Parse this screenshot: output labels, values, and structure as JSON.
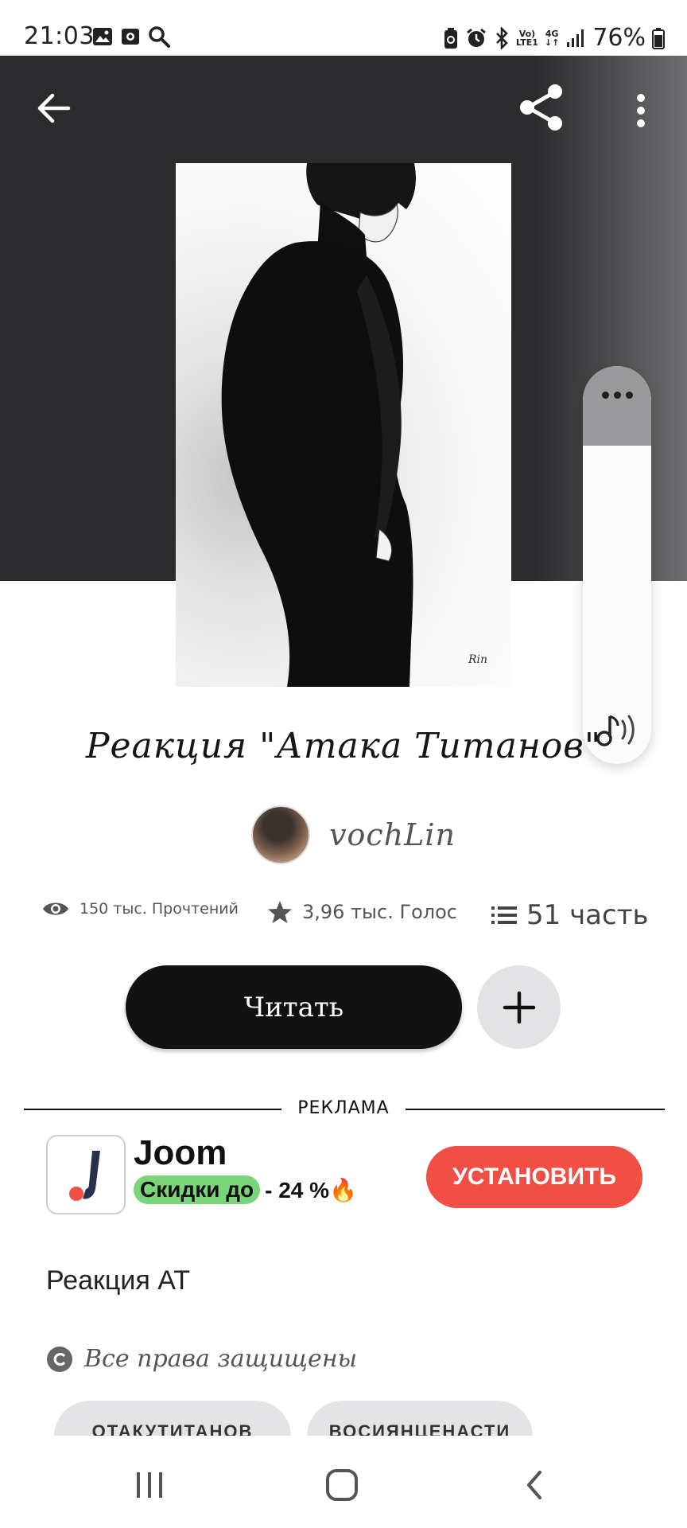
{
  "status_bar": {
    "time": "21:03",
    "battery": "76%",
    "left_icons": [
      "image-icon",
      "screen-record-icon",
      "search-icon"
    ],
    "right_icons": [
      "saver-icon",
      "alarm-icon",
      "bluetooth-icon",
      "volte-icon",
      "4g-icon",
      "signal-icon",
      "battery-icon"
    ],
    "volte_label": "Vo)",
    "lte_label": "LTE1",
    "network_label": "4G"
  },
  "header": {
    "back_icon": "arrow-left-icon",
    "share_icon": "share-icon",
    "more_icon": "more-vertical-icon"
  },
  "story": {
    "title": "Реакция \"Атака Титанов\"",
    "author": "vochLin",
    "reads": "150 тыс. Прочтений",
    "votes": "3,96 тыс. Голос",
    "parts": "51 часть",
    "read_button": "Читать",
    "add_button_icon": "plus-icon",
    "description": "Реакция АТ",
    "copyright": "Все права защищены"
  },
  "ad": {
    "divider_label": "РЕКЛАМА",
    "app_name": "Joom",
    "promo_highlight": "Скидки до",
    "promo_rest": "- 24 %🔥",
    "install_button": "УСТАНОВИТЬ",
    "colors": {
      "install": "#f14e45",
      "highlight": "#7bd47a",
      "logo_accent": "#2a2f4a",
      "logo_dot": "#f14e45"
    }
  },
  "tags": [
    "ОТАКУТИТАНОВ",
    "ВОСИЯНЦЕНАСТИ"
  ],
  "system_nav": {
    "recent_icon": "recent-apps-icon",
    "home_icon": "home-icon",
    "back_icon": "nav-back-icon"
  },
  "colors": {
    "hero_bg": "#2b2b2d",
    "read_button_bg": "#121212",
    "add_button_bg": "#e3e3e5"
  }
}
